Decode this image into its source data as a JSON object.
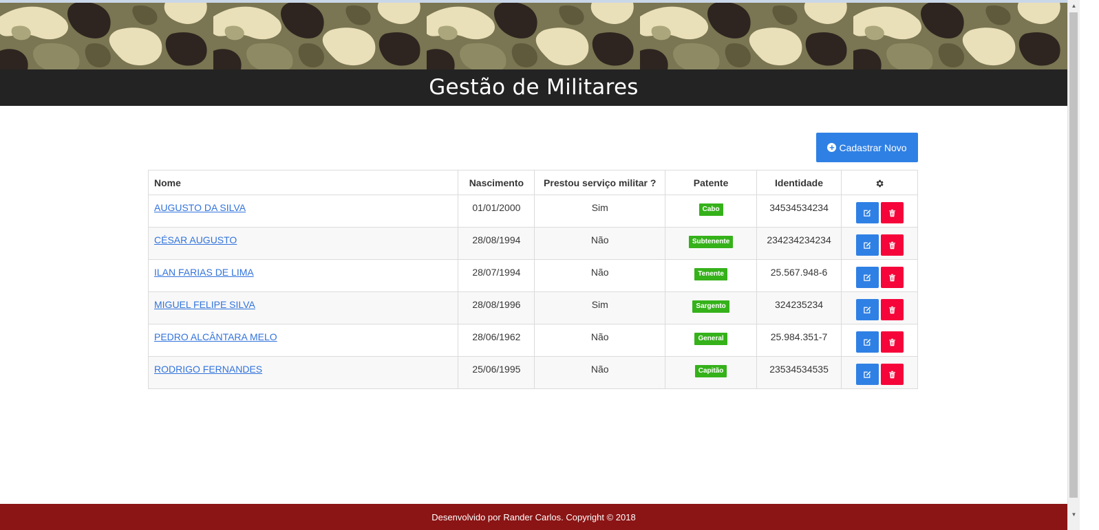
{
  "header": {
    "title": "Gestão de Militares"
  },
  "toolbar": {
    "add_label": "Cadastrar Novo"
  },
  "table": {
    "columns": [
      "Nome",
      "Nascimento",
      "Prestou serviço militar ?",
      "Patente",
      "Identidade"
    ],
    "rows": [
      {
        "nome": "AUGUSTO DA SILVA",
        "nascimento": "01/01/2000",
        "servico": "Sim",
        "patente": "Cabo",
        "identidade": "34534534234"
      },
      {
        "nome": "CÉSAR AUGUSTO",
        "nascimento": "28/08/1994",
        "servico": "Não",
        "patente": "Subtenente",
        "identidade": "234234234234"
      },
      {
        "nome": "ILAN FARIAS DE LIMA",
        "nascimento": "28/07/1994",
        "servico": "Não",
        "patente": "Tenente",
        "identidade": "25.567.948-6"
      },
      {
        "nome": "MIGUEL FELIPE SILVA",
        "nascimento": "28/08/1996",
        "servico": "Sim",
        "patente": "Sargento",
        "identidade": "324235234"
      },
      {
        "nome": "PEDRO ALCÂNTARA MELO",
        "nascimento": "28/06/1962",
        "servico": "Não",
        "patente": "General",
        "identidade": "25.984.351-7"
      },
      {
        "nome": "RODRIGO FERNANDES",
        "nascimento": "25/06/1995",
        "servico": "Não",
        "patente": "Capitão",
        "identidade": "23534534535"
      }
    ]
  },
  "footer": {
    "text": "Desenvolvido por Rander Carlos. Copyright © 2018"
  },
  "colors": {
    "primary": "#2f80e4",
    "danger": "#f5053a",
    "badge": "#35b11a",
    "title_bar": "#232323",
    "footer": "#8b1414",
    "link": "#3273dc"
  },
  "icons": {
    "add": "plus-circle-icon",
    "settings": "gear-icon",
    "edit": "edit-icon",
    "delete": "trash-icon"
  }
}
